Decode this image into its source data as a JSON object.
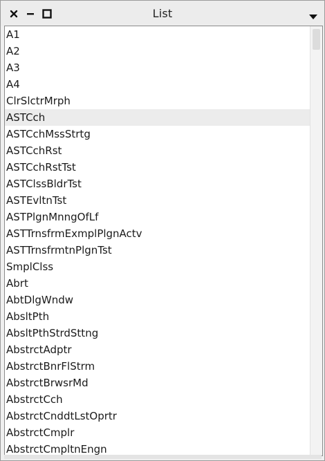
{
  "window": {
    "title": "List"
  },
  "icons": {
    "close": "close-icon",
    "minimize": "minimize-icon",
    "maximize": "maximize-icon",
    "menu": "menu-triangle-icon"
  },
  "list": {
    "selected_index": 5,
    "items": [
      "A1",
      "A2",
      "A3",
      "A4",
      "ClrSlctrMrph",
      "ASTCch",
      "ASTCchMssStrtg",
      "ASTCchRst",
      "ASTCchRstTst",
      "ASTClssBldrTst",
      "ASTEvltnTst",
      "ASTPlgnMnngOfLf",
      "ASTTrnsfrmExmplPlgnActv",
      "ASTTrnsfrmtnPlgnTst",
      "SmplClss",
      "Abrt",
      "AbtDlgWndw",
      "AbsltPth",
      "AbsltPthStrdSttng",
      "AbstrctAdptr",
      "AbstrctBnrFlStrm",
      "AbstrctBrwsrMd",
      "AbstrctCch",
      "AbstrctCnddtLstOprtr",
      "AbstrctCmplr",
      "AbstrctCmpltnEngn"
    ]
  },
  "colors": {
    "selection": "#ececec",
    "titlebar": "#ececec",
    "text": "#1a1a1a"
  }
}
